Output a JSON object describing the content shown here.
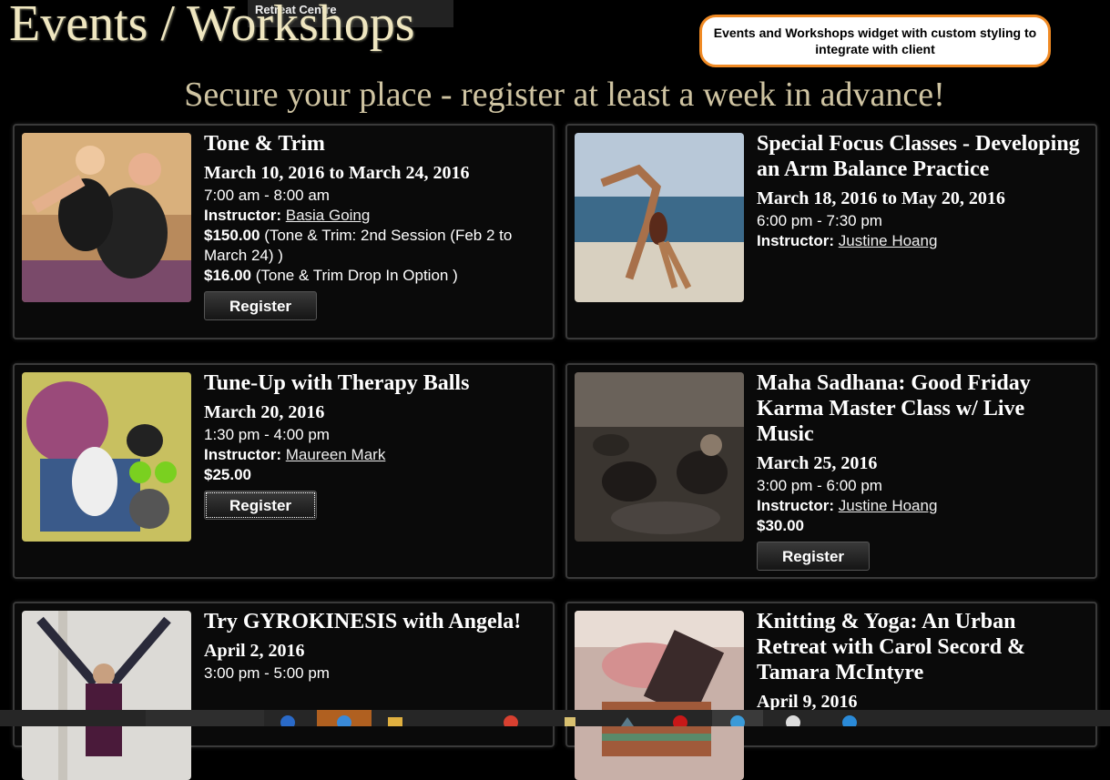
{
  "header": {
    "tooltip": "Retreat Centre",
    "title": "Events / Workshops",
    "callout": "Events and Workshops widget with custom styling to integrate with client",
    "subtitle": "Secure your place - register at least a week in advance!"
  },
  "labels": {
    "instructor": "Instructor:",
    "register": "Register"
  },
  "events": [
    {
      "title": "Tone & Trim",
      "date": "March 10, 2016 to March 24, 2016",
      "time": "7:00 am - 8:00 am",
      "instructor": "Basia Going",
      "price1": "$150.00",
      "price1_note": "(Tone & Trim: 2nd Session (Feb 2 to March 24) )",
      "price2": "$16.00",
      "price2_note": "(Tone & Trim Drop In Option )"
    },
    {
      "title": "Special Focus Classes - Developing an Arm Balance Practice",
      "date": "March 18, 2016 to May 20, 2016",
      "time": "6:00 pm - 7:30 pm",
      "instructor": "Justine Hoang"
    },
    {
      "title": "Tune-Up with Therapy Balls",
      "date": "March 20, 2016",
      "time": "1:30 pm - 4:00 pm",
      "instructor": "Maureen Mark",
      "price1": "$25.00"
    },
    {
      "title": "Maha Sadhana: Good Friday Karma Master Class w/ Live Music",
      "date": "March 25, 2016",
      "time": "3:00 pm - 6:00 pm",
      "instructor": "Justine Hoang",
      "price1": "$30.00"
    },
    {
      "title": "Try GYROKINESIS with Angela!",
      "date": "April 2, 2016",
      "time": "3:00 pm - 5:00 pm"
    },
    {
      "title": "Knitting & Yoga: An Urban Retreat with Carol Secord & Tamara McIntyre",
      "date": "April 9, 2016"
    }
  ],
  "colors": {
    "background": "#000000",
    "title": "#efe6c0",
    "subtitle": "#cfc4a2",
    "callout_border": "#f08a24",
    "card_border": "#3a3a3a"
  }
}
